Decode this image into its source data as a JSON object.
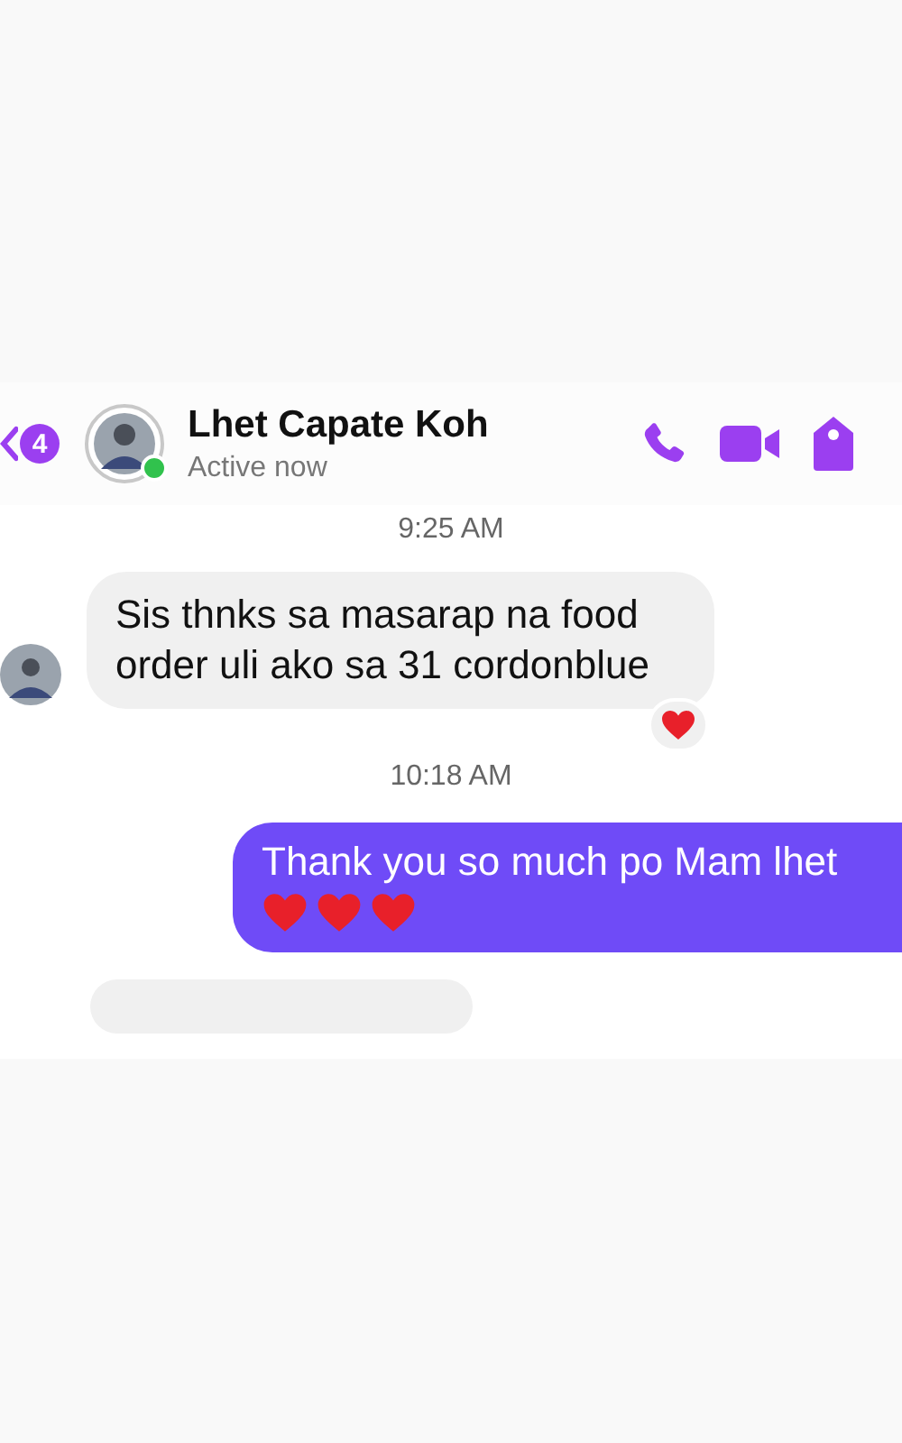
{
  "header": {
    "unread_count": "4",
    "name": "Lhet Capate Koh",
    "status": "Active now",
    "online": true
  },
  "messages": [
    {
      "kind": "time",
      "text": "9:25 AM"
    },
    {
      "kind": "incoming",
      "text": "Sis thnks sa masarap na food order uli ako sa 31 cordonblue",
      "reaction": {
        "kind": "heart"
      }
    },
    {
      "kind": "time",
      "text": "10:18 AM"
    },
    {
      "kind": "outgoing",
      "text": "Thank you so much po Mam lhet",
      "emoji": [
        {
          "kind": "heart"
        },
        {
          "kind": "heart"
        },
        {
          "kind": "heart"
        }
      ]
    },
    {
      "kind": "incoming_cut"
    }
  ]
}
